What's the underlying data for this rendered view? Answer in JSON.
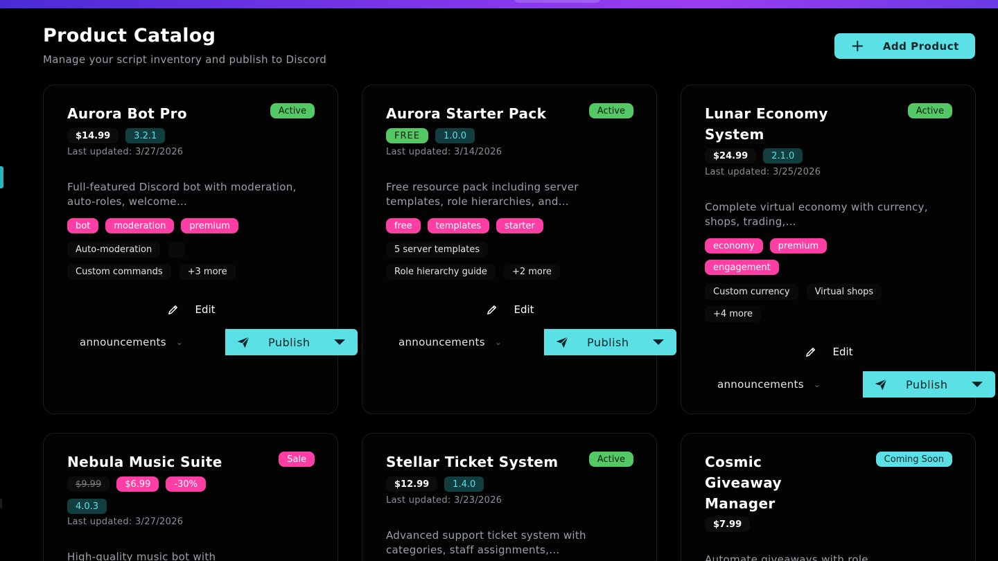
{
  "header": {
    "title": "Product Catalog",
    "subtitle": "Manage your script inventory and publish to Discord",
    "add_label": "Add Product",
    "add_icon": "plus-icon"
  },
  "common": {
    "edit_label": "Edit",
    "publish_label": "Publish",
    "channel": "announcements",
    "accent": "#5be0e6",
    "active_color": "#55c866",
    "tag_color": "#ff3ea5"
  },
  "cards": [
    {
      "title": "Aurora Bot Pro",
      "status": "Active",
      "price": "$14.99",
      "version": "3.2.1",
      "updated": "Last updated: 3/27/2026",
      "description": "Full-featured Discord bot with moderation, auto-roles, welcome…",
      "tags": [
        "bot",
        "moderation",
        "premium"
      ],
      "features": [
        "Auto-moderation",
        "Custom commands",
        "+3 more"
      ]
    },
    {
      "title": "Aurora Starter Pack",
      "status": "Active",
      "price": "FREE",
      "version": "1.0.0",
      "updated": "Last updated: 3/14/2026",
      "description": "Free resource pack including server templates, role hierarchies, and…",
      "tags": [
        "free",
        "templates",
        "starter"
      ],
      "features": [
        "5 server templates",
        "Role hierarchy guide",
        "+2 more"
      ]
    },
    {
      "title": "Lunar Economy System",
      "status": "Active",
      "price": "$24.99",
      "version": "2.1.0",
      "updated": "Last updated: 3/25/2026",
      "description": "Complete virtual economy with currency, shops, trading,…",
      "tags": [
        "economy",
        "premium",
        "engagement"
      ],
      "features": [
        "Custom currency",
        "Virtual shops",
        "+4 more"
      ]
    },
    {
      "title": "Nebula Music Suite",
      "status": "Sale",
      "old_price": "$9.99",
      "price": "$6.99",
      "discount": "-30%",
      "version": "4.0.3",
      "updated": "Last updated: 3/27/2026",
      "description": "High-quality music bot with"
    },
    {
      "title": "Stellar Ticket System",
      "status": "Active",
      "price": "$12.99",
      "version": "1.4.0",
      "updated": "Last updated: 3/23/2026",
      "description": "Advanced support ticket system with categories, staff assignments,…"
    },
    {
      "title": "Cosmic Giveaway Manager",
      "status": "Coming Soon",
      "price": "$7.99",
      "description": "Automate giveaways with role"
    }
  ]
}
